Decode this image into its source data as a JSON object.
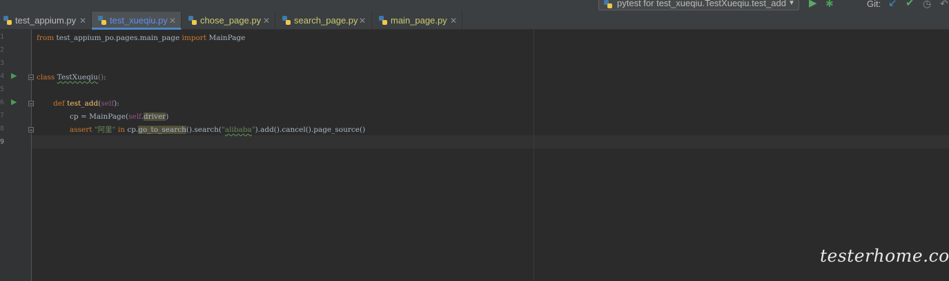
{
  "toolbar": {
    "run_config": "pytest for test_xueqiu.TestXueqiu.test_add",
    "git_label": "Git:"
  },
  "tabs": [
    {
      "label": "test_appium.py",
      "state": "normal"
    },
    {
      "label": "test_xueqiu.py",
      "state": "active"
    },
    {
      "label": "chose_page.py",
      "state": "changed"
    },
    {
      "label": "search_page.py",
      "state": "changed"
    },
    {
      "label": "main_page.py",
      "state": "changed"
    }
  ],
  "line_numbers": [
    "1",
    "2",
    "3",
    "4",
    "5",
    "6",
    "7",
    "8",
    "9"
  ],
  "current_line": "9",
  "code": {
    "l1": {
      "kw_from": "from",
      "module": " test_appium_po.pages.main_page ",
      "kw_import": "import",
      "name": " MainPage"
    },
    "l4": {
      "kw_class": "class",
      "space": " ",
      "cls": "TestXueqiu",
      "parens": "()",
      "colon": ":"
    },
    "l6": {
      "kw_def": "def",
      "space": " ",
      "fn": "test_add",
      "open": "(",
      "self": "self",
      "close": ")",
      "colon": ":"
    },
    "l7": {
      "lhs": "cp = MainPage(",
      "self": "self",
      "dot": ".",
      "attr": "driver",
      "close": ")"
    },
    "l8": {
      "kw_assert": "assert",
      "space1": " ",
      "str1": "\"阿里\"",
      "space2": " ",
      "kw_in": "in",
      "obj": " cp.",
      "meth1": "go_to_search",
      "mid": "().search(",
      "q1": "\"",
      "str2": "alibaba",
      "q2": "\"",
      "tail": ").add().cancel().page_source()"
    }
  },
  "watermark": "testerhome.com",
  "colors": {
    "background": "#2b2b2b",
    "gutter": "#313335",
    "keyword": "#cc7832",
    "function": "#ffc66d",
    "string": "#6a8759",
    "self": "#94558d",
    "active_tab_text": "#5f8ff0"
  }
}
